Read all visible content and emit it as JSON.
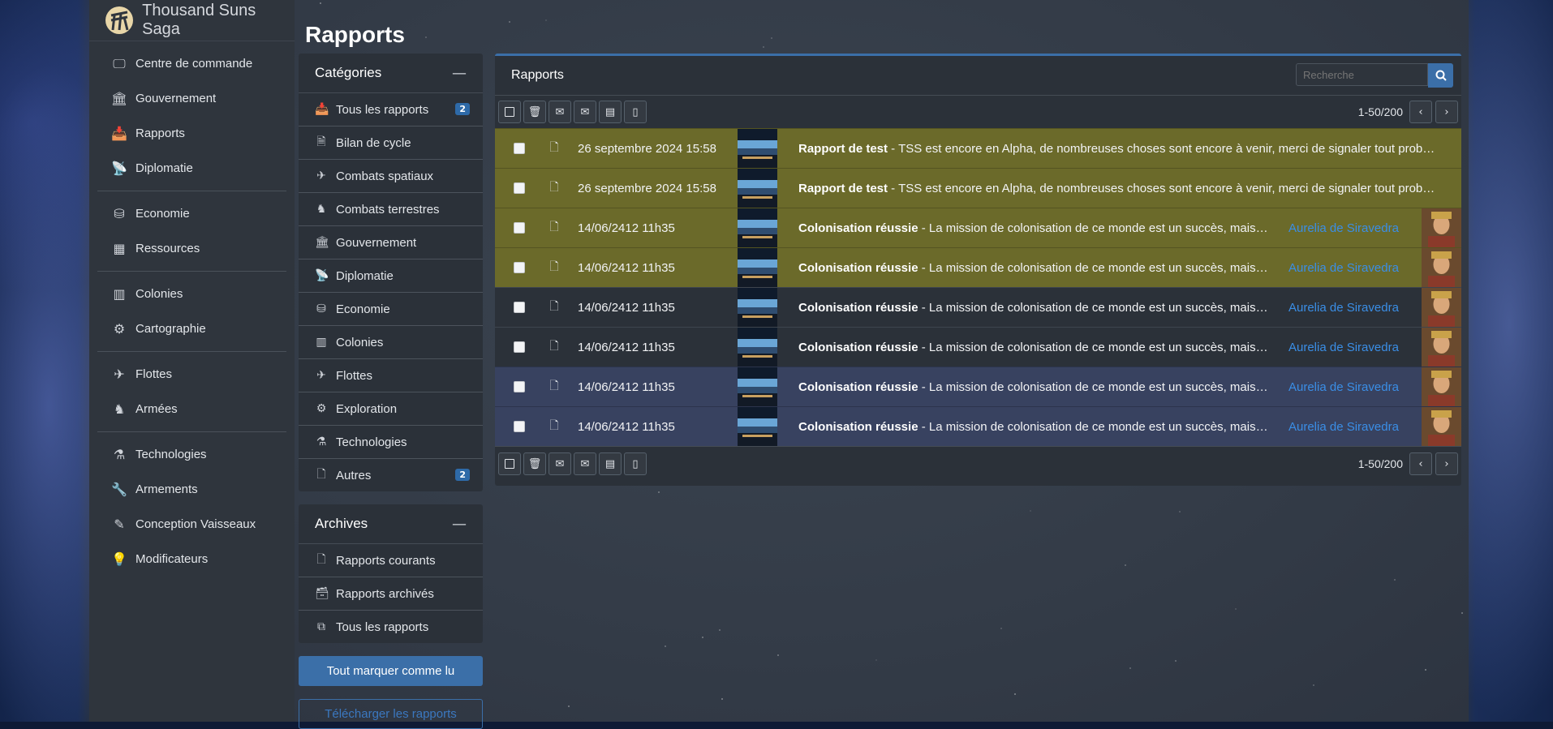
{
  "brand": {
    "name": "Thousand Suns Saga"
  },
  "page": {
    "title": "Rapports"
  },
  "sidebar": {
    "groups": [
      [
        {
          "label": "Centre de commande",
          "icon": "monitor-icon"
        },
        {
          "label": "Gouvernement",
          "icon": "building-icon"
        },
        {
          "label": "Rapports",
          "icon": "inbox-icon"
        },
        {
          "label": "Diplomatie",
          "icon": "antenna-icon"
        }
      ],
      [
        {
          "label": "Economie",
          "icon": "coins-icon"
        },
        {
          "label": "Ressources",
          "icon": "boxes-icon"
        }
      ],
      [
        {
          "label": "Colonies",
          "icon": "city-icon"
        },
        {
          "label": "Cartographie",
          "icon": "gear-icon"
        }
      ],
      [
        {
          "label": "Flottes",
          "icon": "jet-icon"
        },
        {
          "label": "Armées",
          "icon": "soldier-icon"
        }
      ],
      [
        {
          "label": "Technologies",
          "icon": "flask-icon"
        },
        {
          "label": "Armements",
          "icon": "wrench-icon"
        },
        {
          "label": "Conception Vaisseaux",
          "icon": "compass-icon"
        },
        {
          "label": "Modificateurs",
          "icon": "bulb-icon"
        }
      ]
    ]
  },
  "categories": {
    "title": "Catégories",
    "items": [
      {
        "label": "Tous les rapports",
        "icon": "inbox-icon",
        "badge": "2"
      },
      {
        "label": "Bilan de cycle",
        "icon": "file-text-icon"
      },
      {
        "label": "Combats spatiaux",
        "icon": "jet-icon"
      },
      {
        "label": "Combats terrestres",
        "icon": "soldier-icon"
      },
      {
        "label": "Gouvernement",
        "icon": "building-icon"
      },
      {
        "label": "Diplomatie",
        "icon": "antenna-icon"
      },
      {
        "label": "Economie",
        "icon": "coins-icon"
      },
      {
        "label": "Colonies",
        "icon": "city-icon"
      },
      {
        "label": "Flottes",
        "icon": "jet-icon"
      },
      {
        "label": "Exploration",
        "icon": "gear-icon"
      },
      {
        "label": "Technologies",
        "icon": "flask-icon"
      },
      {
        "label": "Autres",
        "icon": "file-icon",
        "badge": "2"
      }
    ]
  },
  "archives": {
    "title": "Archives",
    "items": [
      {
        "label": "Rapports courants",
        "icon": "file-icon"
      },
      {
        "label": "Rapports archivés",
        "icon": "file-archive-icon"
      },
      {
        "label": "Tous les rapports",
        "icon": "copy-icon"
      }
    ]
  },
  "actions": {
    "mark_all_read": "Tout marquer comme lu",
    "download": "Télécharger les rapports"
  },
  "reports": {
    "title": "Rapports",
    "search_placeholder": "Recherche",
    "range": "1-50/200",
    "rows": [
      {
        "date": "26 septembre 2024 15:58",
        "subject": "Rapport de test",
        "preview": " - TSS est encore en Alpha, de nombreuses choses sont encore à venir, merci de signaler tout problème rencontré",
        "sender": "",
        "state": "unread"
      },
      {
        "date": "26 septembre 2024 15:58",
        "subject": "Rapport de test",
        "preview": " - TSS est encore en Alpha, de nombreuses choses sont encore à venir, merci de signaler tout problème rencontré",
        "sender": "",
        "state": "unread"
      },
      {
        "date": "14/06/2412 11h35",
        "subject": "Colonisation réussie",
        "preview": " - La mission de colonisation de ce monde est un succès, mais vos colons",
        "sender": "Aurelia de Siravedra",
        "state": "unread"
      },
      {
        "date": "14/06/2412 11h35",
        "subject": "Colonisation réussie",
        "preview": " - La mission de colonisation de ce monde est un succès, mais vos colons",
        "sender": "Aurelia de Siravedra",
        "state": "unread"
      },
      {
        "date": "14/06/2412 11h35",
        "subject": "Colonisation réussie",
        "preview": " - La mission de colonisation de ce monde est un succès, mais vos colons",
        "sender": "Aurelia de Siravedra",
        "state": "plain"
      },
      {
        "date": "14/06/2412 11h35",
        "subject": "Colonisation réussie",
        "preview": " - La mission de colonisation de ce monde est un succès, mais vos colons",
        "sender": "Aurelia de Siravedra",
        "state": "plain"
      },
      {
        "date": "14/06/2412 11h35",
        "subject": "Colonisation réussie",
        "preview": " - La mission de colonisation de ce monde est un succès, mais vos colons",
        "sender": "Aurelia de Siravedra",
        "state": "sel"
      },
      {
        "date": "14/06/2412 11h35",
        "subject": "Colonisation réussie",
        "preview": " - La mission de colonisation de ce monde est un succès, mais vos colons",
        "sender": "Aurelia de Siravedra",
        "state": "sel"
      }
    ]
  },
  "colors": {
    "accent": "#3b6fa8",
    "unread_row": "#6b6a2a",
    "selected_row": "#384260",
    "link": "#3a8ee6"
  }
}
